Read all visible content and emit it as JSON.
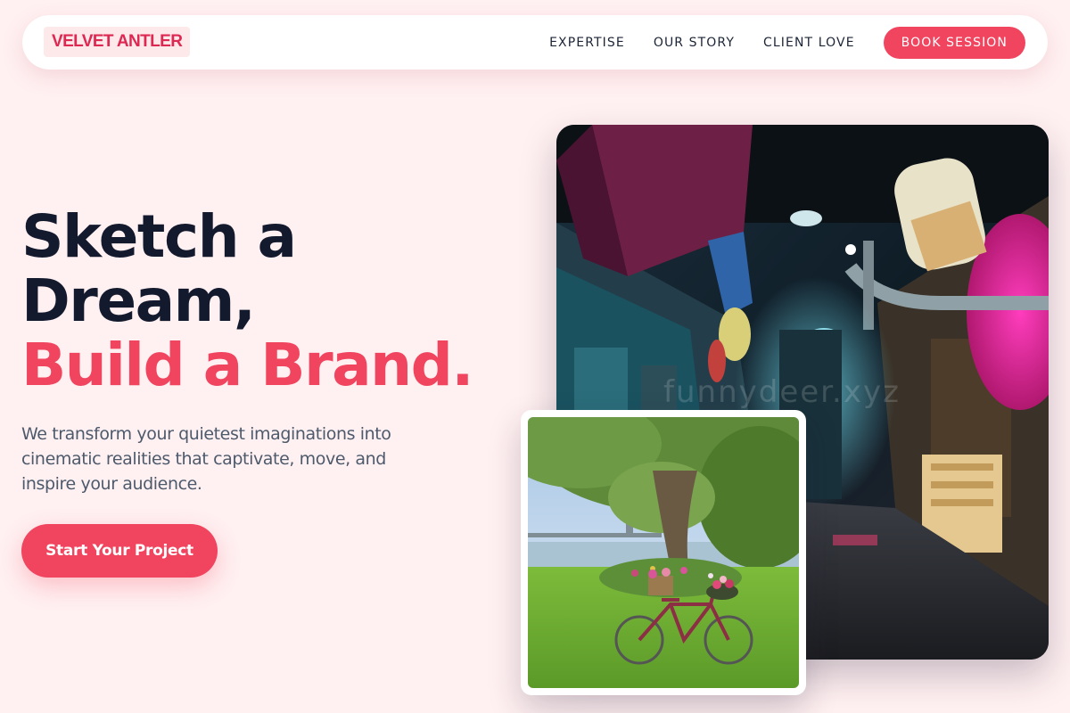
{
  "brand": {
    "logo_text": "VELVET ANTLER"
  },
  "nav": {
    "links": [
      "EXPERTISE",
      "OUR STORY",
      "CLIENT LOVE"
    ],
    "cta_label": "BOOK SESSION"
  },
  "hero": {
    "headline_line1": "Sketch a",
    "headline_line2": "Dream,",
    "headline_accent": "Build a Brand.",
    "subtext": "We transform your quietest imaginations into cinematic realities that captivate, move, and inspire your audience.",
    "cta_label": "Start Your Project"
  },
  "images": {
    "main_watermark": "funnydeer.xyz"
  },
  "colors": {
    "background": "#fff0f1",
    "accent": "#f0445f",
    "logo": "#dd2852",
    "heading": "#141a2e",
    "body_text": "#4d5a6c"
  }
}
